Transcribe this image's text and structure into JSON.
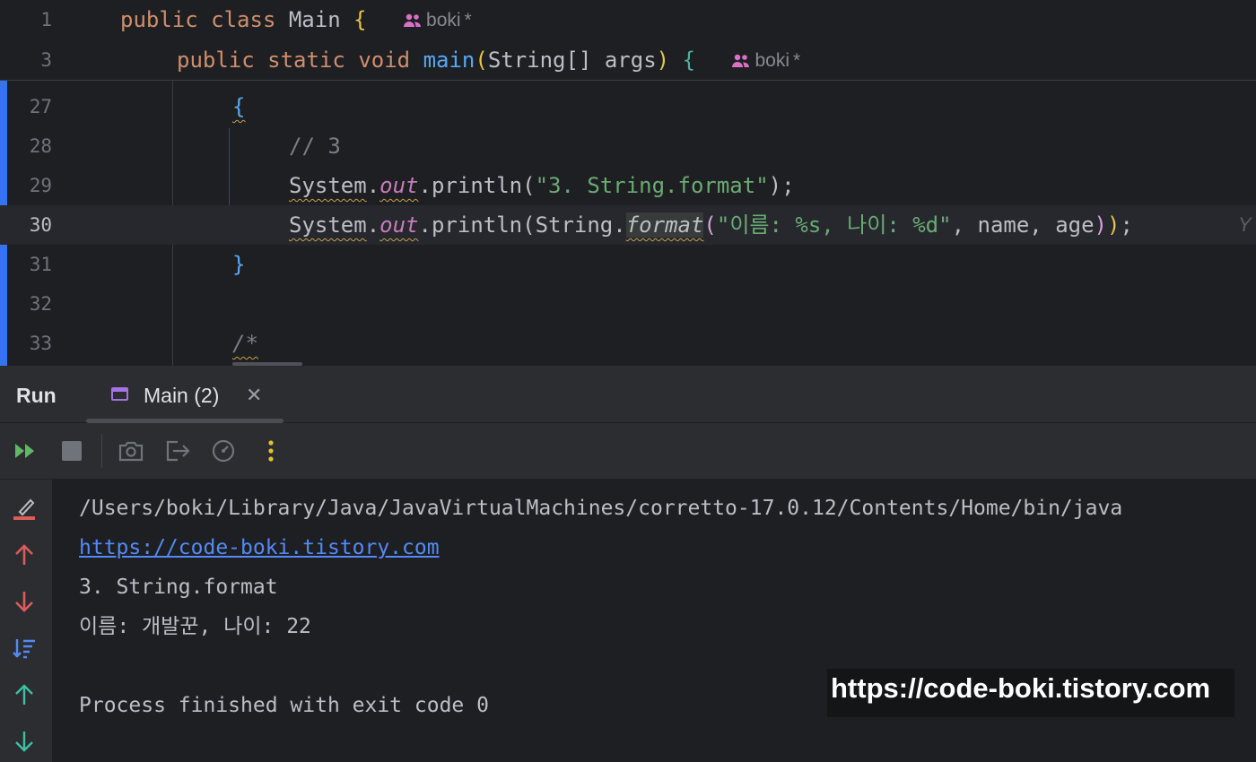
{
  "sticky": {
    "line1": {
      "num": "1",
      "kw1": "public",
      "kw2": "class",
      "name": "Main",
      "brace": "{",
      "author": "boki",
      "author_mark": "*"
    },
    "line2": {
      "num": "3",
      "kw1": "public",
      "kw2": "static",
      "kw3": "void",
      "method": "main",
      "open": "(",
      "type": "String[]",
      "arg": "args",
      "close": ")",
      "brace": "{",
      "author": "boki",
      "author_mark": "*"
    }
  },
  "editor": {
    "lines": [
      {
        "num": "27"
      },
      {
        "num": "28"
      },
      {
        "num": "29"
      },
      {
        "num": "30"
      },
      {
        "num": "31"
      },
      {
        "num": "32"
      },
      {
        "num": "33"
      }
    ],
    "l27_brace": "{",
    "l28_comment": "// 3",
    "l29": {
      "obj": "System",
      "dot": ".",
      "field": "out",
      "call": ".println(",
      "str": "\"3. String.format\"",
      "end": ");"
    },
    "l30": {
      "obj": "System",
      "dot": ".",
      "field": "out",
      "call": ".println(",
      "cls": "String.",
      "method": "format",
      "open": "(",
      "str": "\"이름: %s, 나이: %d\"",
      "args": ", name, age",
      "close1": ")",
      "close2": ")",
      "end": ";",
      "inlay": "Y"
    },
    "l31_brace": "}",
    "l33_comment": "/*"
  },
  "run": {
    "title": "Run",
    "tab_label": "Main (2)",
    "tab_close": "✕"
  },
  "console": {
    "lines": [
      "/Users/boki/Library/Java/JavaVirtualMachines/corretto-17.0.12/Contents/Home/bin/java",
      "https://code-boki.tistory.com",
      "3. String.format",
      "이름: 개발꾼, 나이: 22",
      "",
      "Process finished with exit code 0"
    ]
  },
  "watermark": "https://code-boki.tistory.com",
  "icons": {
    "author": "people-icon",
    "rerun": "rerun-icon",
    "stop": "stop-icon",
    "screenshot": "camera-icon",
    "exit": "exit-icon",
    "profiler": "gauge-icon",
    "more": "more-vertical-icon",
    "clear": "clear-icon",
    "up": "arrow-up-icon",
    "down": "arrow-down-icon",
    "sort": "sort-icon",
    "prev": "previous-icon",
    "next": "next-icon"
  },
  "colors": {
    "keyword": "#cf8e6d",
    "method": "#56a8f5",
    "string": "#6aab73",
    "field": "#c77dbb",
    "comment": "#7a7e85",
    "link": "#548af7",
    "rerun_green": "#5fb865",
    "stop_gray": "#6f737a",
    "arrow_red": "#db5c5c",
    "arrow_teal": "#3fbfa3",
    "more_yellow": "#e5c12e",
    "tab_purple": "#a571e6"
  }
}
